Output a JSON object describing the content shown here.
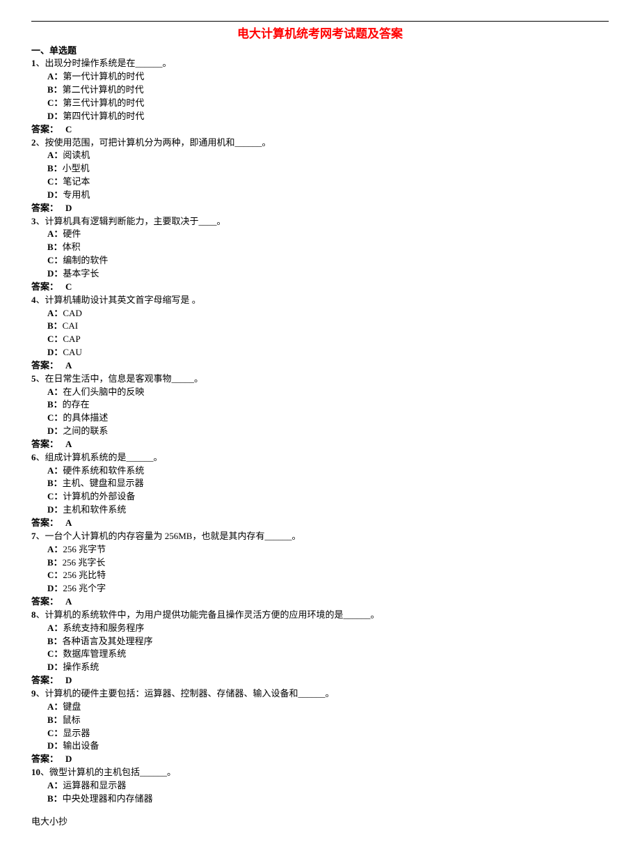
{
  "title": "电大计算机统考网考试题及答案",
  "section_header": "一、单选题",
  "questions": [
    {
      "num": "1",
      "text": "、出现分时操作系统是在______。",
      "options": [
        {
          "label": "A：",
          "text": "第一代计算机的时代"
        },
        {
          "label": "B：",
          "text": "第二代计算机的时代"
        },
        {
          "label": "C：",
          "text": "第三代计算机的时代"
        },
        {
          "label": "D：",
          "text": "第四代计算机的时代"
        }
      ],
      "answer_label": "答案：",
      "answer_value": "C"
    },
    {
      "num": "2",
      "text": "、按使用范围，可把计算机分为两种，即通用机和______。",
      "options": [
        {
          "label": "A：",
          "text": "阅读机"
        },
        {
          "label": "B：",
          "text": "小型机"
        },
        {
          "label": "C：",
          "text": "笔记本"
        },
        {
          "label": "D：",
          "text": "专用机"
        }
      ],
      "answer_label": "答案：",
      "answer_value": "D"
    },
    {
      "num": "3",
      "text": "、计算机具有逻辑判断能力，主要取决于____。",
      "options": [
        {
          "label": "A：",
          "text": "硬件"
        },
        {
          "label": "B：",
          "text": "体积"
        },
        {
          "label": "C：",
          "text": "编制的软件"
        },
        {
          "label": "D：",
          "text": "基本字长"
        }
      ],
      "answer_label": "答案：",
      "answer_value": "C"
    },
    {
      "num": "4",
      "text": "、计算机辅助设计其英文首字母缩写是       。",
      "options": [
        {
          "label": "A：",
          "text": "CAD"
        },
        {
          "label": "B：",
          "text": "CAI"
        },
        {
          "label": "C：",
          "text": "CAP"
        },
        {
          "label": "D：",
          "text": "CAU"
        }
      ],
      "answer_label": "答案：",
      "answer_value": "A"
    },
    {
      "num": "5",
      "text": "、在日常生活中，信息是客观事物_____。",
      "options": [
        {
          "label": "A：",
          "text": "在人们头脑中的反映"
        },
        {
          "label": "B：",
          "text": "的存在"
        },
        {
          "label": "C：",
          "text": "的具体描述"
        },
        {
          "label": "D：",
          "text": "之间的联系"
        }
      ],
      "answer_label": "答案：",
      "answer_value": "A"
    },
    {
      "num": "6",
      "text": "、组成计算机系统的是______。",
      "options": [
        {
          "label": "A：",
          "text": "硬件系统和软件系统"
        },
        {
          "label": "B：",
          "text": "主机、键盘和显示器"
        },
        {
          "label": "C：",
          "text": "计算机的外部设备"
        },
        {
          "label": "D：",
          "text": "主机和软件系统"
        }
      ],
      "answer_label": "答案：",
      "answer_value": "A"
    },
    {
      "num": "7",
      "text": "、一台个人计算机的内存容量为 256MB，也就是其内存有______。",
      "options": [
        {
          "label": "A：",
          "text": "256 兆字节"
        },
        {
          "label": "B：",
          "text": "256 兆字长"
        },
        {
          "label": "C：",
          "text": "256 兆比特"
        },
        {
          "label": "D：",
          "text": "256 兆个字"
        }
      ],
      "answer_label": "答案：",
      "answer_value": "A"
    },
    {
      "num": "8",
      "text": "、计算机的系统软件中，为用户提供功能完备且操作灵活方便的应用环境的是______。",
      "options": [
        {
          "label": "A：",
          "text": "系统支持和服务程序"
        },
        {
          "label": "B：",
          "text": "各种语言及其处理程序"
        },
        {
          "label": "C：",
          "text": "数据库管理系统"
        },
        {
          "label": "D：",
          "text": "操作系统"
        }
      ],
      "answer_label": "答案：",
      "answer_value": "D"
    },
    {
      "num": "9",
      "text": "、计算机的硬件主要包括：运算器、控制器、存储器、输入设备和______。",
      "options": [
        {
          "label": "A：",
          "text": "键盘"
        },
        {
          "label": "B：",
          "text": "鼠标"
        },
        {
          "label": "C：",
          "text": "显示器"
        },
        {
          "label": "D：",
          "text": "输出设备"
        }
      ],
      "answer_label": "答案：",
      "answer_value": "D"
    },
    {
      "num": "10",
      "text": "、微型计算机的主机包括______。",
      "options": [
        {
          "label": "A：",
          "text": "运算器和显示器"
        },
        {
          "label": "B：",
          "text": "中央处理器和内存储器"
        }
      ],
      "answer_label": "",
      "answer_value": ""
    }
  ],
  "footer": "电大小抄"
}
